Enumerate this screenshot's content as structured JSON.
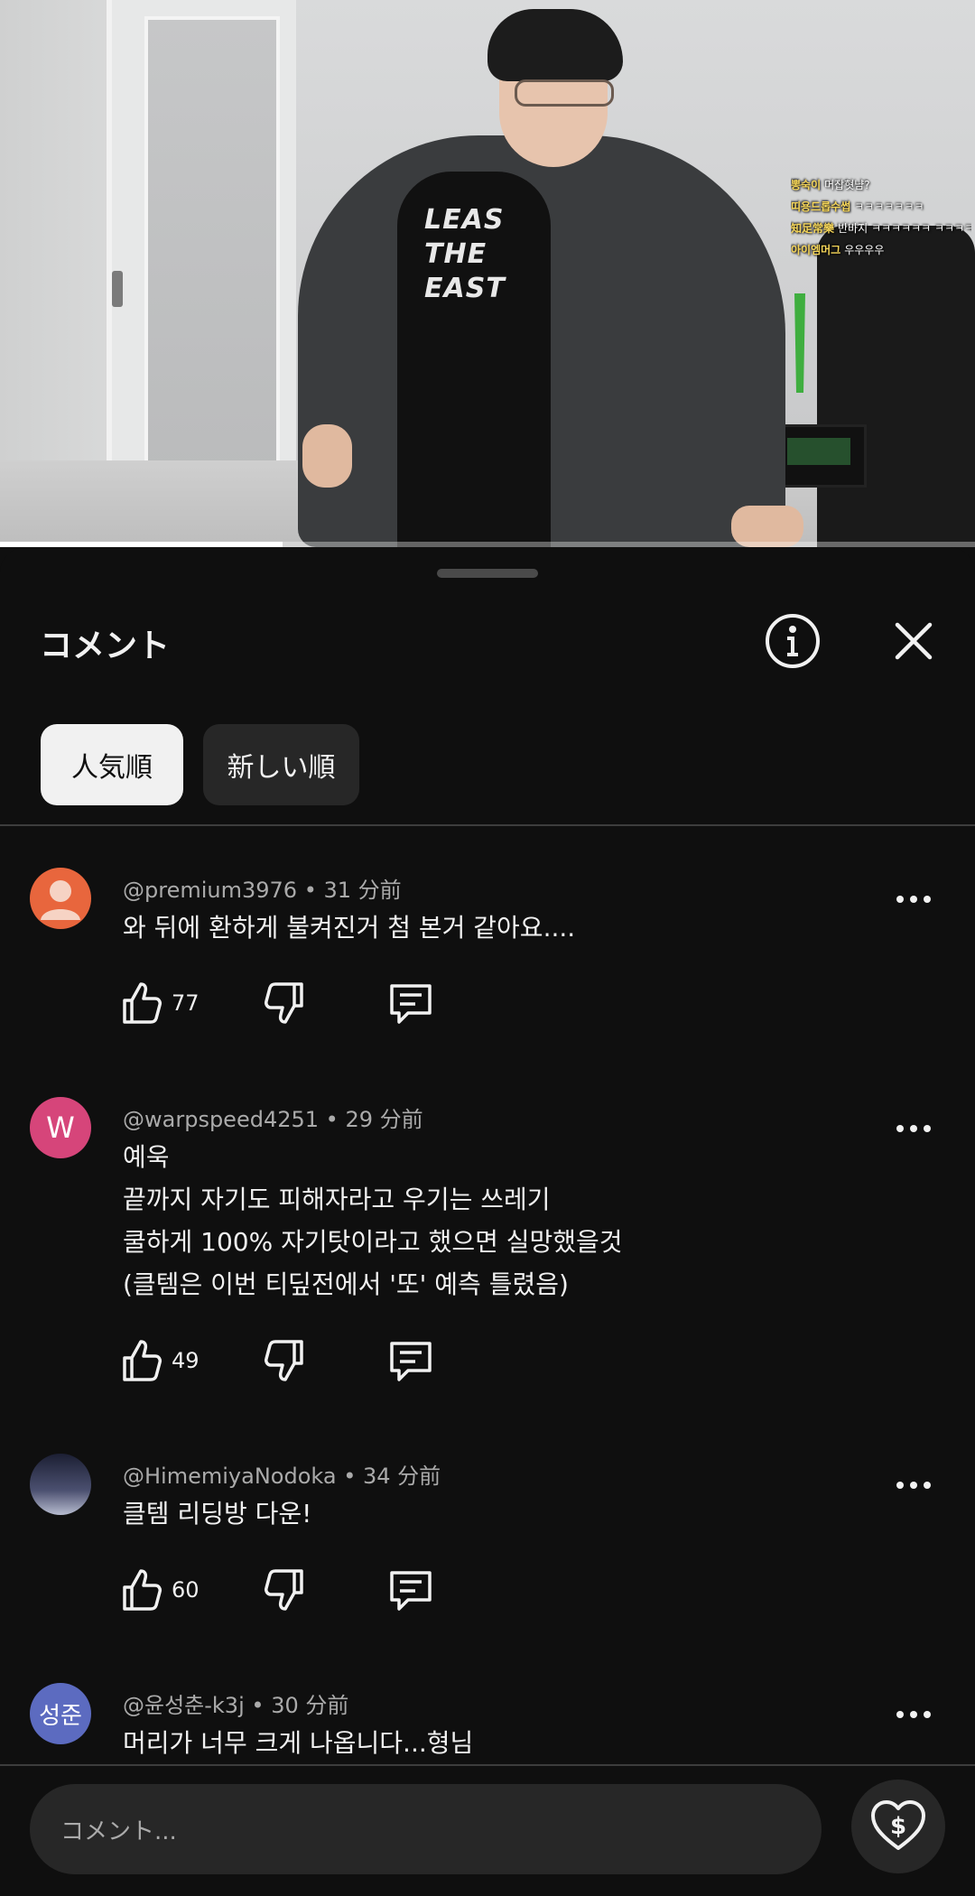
{
  "video": {
    "shirt_text": [
      "LEAS",
      "THE",
      "EAST"
    ],
    "chat": [
      {
        "user": "뽕숙이",
        "msg": "머잡혓냠?"
      },
      {
        "user": "띠용드롭수썹",
        "msg": "ㅋㅋㅋㅋㅋㅋㅋ"
      },
      {
        "user": "知足常樂",
        "msg": "반바지 ㅋㅋㅋㅋㅋㅋ ㅋㅋㅋㅋㅋ"
      },
      {
        "user": "아이엠머그",
        "msg": "우우우우"
      }
    ],
    "progress": 0.29
  },
  "sheet": {
    "title": "コメント",
    "info_icon": "info-icon",
    "close_icon": "close-icon",
    "sort_chips": [
      {
        "label": "人気順",
        "active": true
      },
      {
        "label": "新しい順",
        "active": false
      }
    ]
  },
  "comments": [
    {
      "author": "@premium3976",
      "time": "31 分前",
      "avatar": {
        "type": "default-person",
        "color": "#e8663d"
      },
      "lines": [
        "와 뒤에 환하게 불켜진거 첨 본거 같아요...."
      ],
      "likes": "77"
    },
    {
      "author": "@warpspeed4251",
      "time": "29 分前",
      "avatar": {
        "type": "letter",
        "letter": "W",
        "color": "#d6457a"
      },
      "lines": [
        "예욱",
        "끝까지 자기도 피해자라고 우기는 쓰레기",
        "쿨하게 100% 자기탓이라고 했으면 실망했을것",
        "(클템은 이번 티딮전에서 '또' 예측 틀렸음)"
      ],
      "likes": "49"
    },
    {
      "author": "@HimemiyaNodoka",
      "time": "34 分前",
      "avatar": {
        "type": "image",
        "color": "#3b3f5a"
      },
      "lines": [
        "클템 리딩방 다운!"
      ],
      "likes": "60"
    },
    {
      "author": "@윤성춘-k3j",
      "time": "30 分前",
      "avatar": {
        "type": "letter",
        "letter": "성준",
        "color": "#5c6bc0"
      },
      "lines": [
        "머리가 너무 크게 나옵니다...형님"
      ],
      "likes": ""
    }
  ],
  "input": {
    "placeholder": "コメント..."
  },
  "colors": {
    "background": "#0f0f0f",
    "chip_active": "#f1f1f1",
    "chip_inactive": "#272727",
    "secondary_text": "#aaaaaa"
  }
}
